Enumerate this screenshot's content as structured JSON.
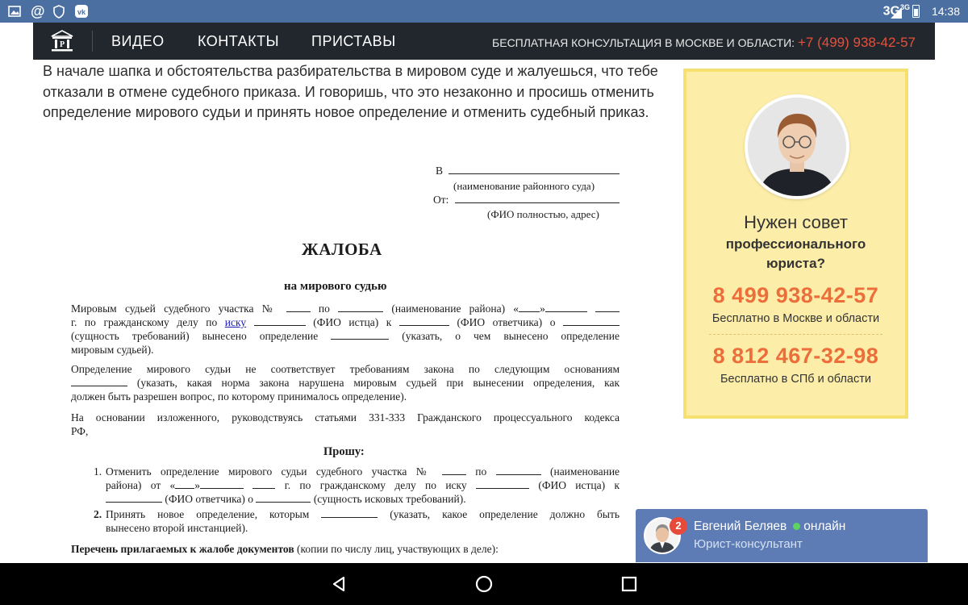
{
  "status_bar": {
    "network": "3G",
    "network_sup": "3G",
    "time": "14:38",
    "icons": [
      "image-icon",
      "at-sign-icon",
      "shield-icon",
      "vk-icon",
      "signal-icon",
      "battery-icon"
    ]
  },
  "nav": {
    "links": [
      "ВИДЕО",
      "КОНТАКТЫ",
      "ПРИСТАВЫ"
    ],
    "consult_label": "БЕСПЛАТНАЯ КОНСУЛЬТАЦИЯ В МОСКВЕ И ОБЛАСТИ:",
    "consult_phone": "+7 (499) 938-42-57"
  },
  "intro": {
    "text": "В начале шапка и обстоятельства разбирательства в мировом суде и жалуешься, что тебе отказали в отмене судебного приказа. И говоришь, что это незаконно и просишь отменить определение мирового судьи и принять новое определение и отменить судебный приказ."
  },
  "document": {
    "to_label": "В",
    "to_hint": "(наименование районного суда)",
    "from_label": "От:",
    "from_hint": "(ФИО полностью, адрес)",
    "title": "ЖАЛОБА",
    "subtitle": "на мирового судью",
    "p1_l1": [
      "Мировым судьей судебного участка №",
      "по",
      "(наименование района) «",
      "»"
    ],
    "p1_l2": [
      "г. по гражданскому делу по",
      "иску",
      "(ФИО истца) к",
      "(ФИО ответчика) о"
    ],
    "p1_l3": [
      "(сущность требований) вынесено определение",
      "(указать, о чем вынесено определение"
    ],
    "p1_l4": "мировым судьей).",
    "p2_l1": "Определение мирового судьи не соответствует требованиям закона по следующим основаниям",
    "p2_l2": "(указать, какая норма закона нарушена мировым судьей при вынесении определения, как",
    "p2_l3": "должен быть разрешен вопрос, по которому принималось определение).",
    "p3_l1": "На основании изложенного, руководствуясь статьями 331-333 Гражданского процессуального кодекса",
    "p3_l2": "РФ,",
    "request": "Прошу:",
    "item1_num": "1.",
    "item1_l1": [
      "Отменить определение мирового судьи судебного участка №",
      "по",
      "(наименование"
    ],
    "item1_l2": [
      "района) от «",
      "»",
      "г. по гражданскому делу по иску",
      "(ФИО истца) к"
    ],
    "item1_l3": [
      "(ФИО ответчика) о",
      "(сущность исковых требований)."
    ],
    "item2_num": "2.",
    "item2_l1": [
      "Принять новое определение, которым",
      "(указать, какое определение должно быть"
    ],
    "item2_l2": "вынесено второй инстанцией).",
    "list_bold": "Перечень прилагаемых к жалобе документов",
    "list_rest": "(копии по числу лиц, участвующих в деле):"
  },
  "promo": {
    "line1": "Нужен совет",
    "line2": "профессионального",
    "line3": "юриста?",
    "phone1": "8 499 938-42-57",
    "note1": "Бесплатно в Москве и области",
    "phone2": "8 812 467-32-98",
    "note2": "Бесплатно в СПб и области"
  },
  "chat": {
    "badge": "2",
    "name": "Евгений Беляев",
    "status": "онлайн",
    "role": "Юрист-консультант"
  },
  "colors": {
    "status_bar": "#4a6fa0",
    "navbar": "#22272d",
    "accent_red": "#e8503a",
    "promo_bg": "#fceea8",
    "promo_phone": "#ec6e3a",
    "chat_bg": "#5d7cb6"
  }
}
